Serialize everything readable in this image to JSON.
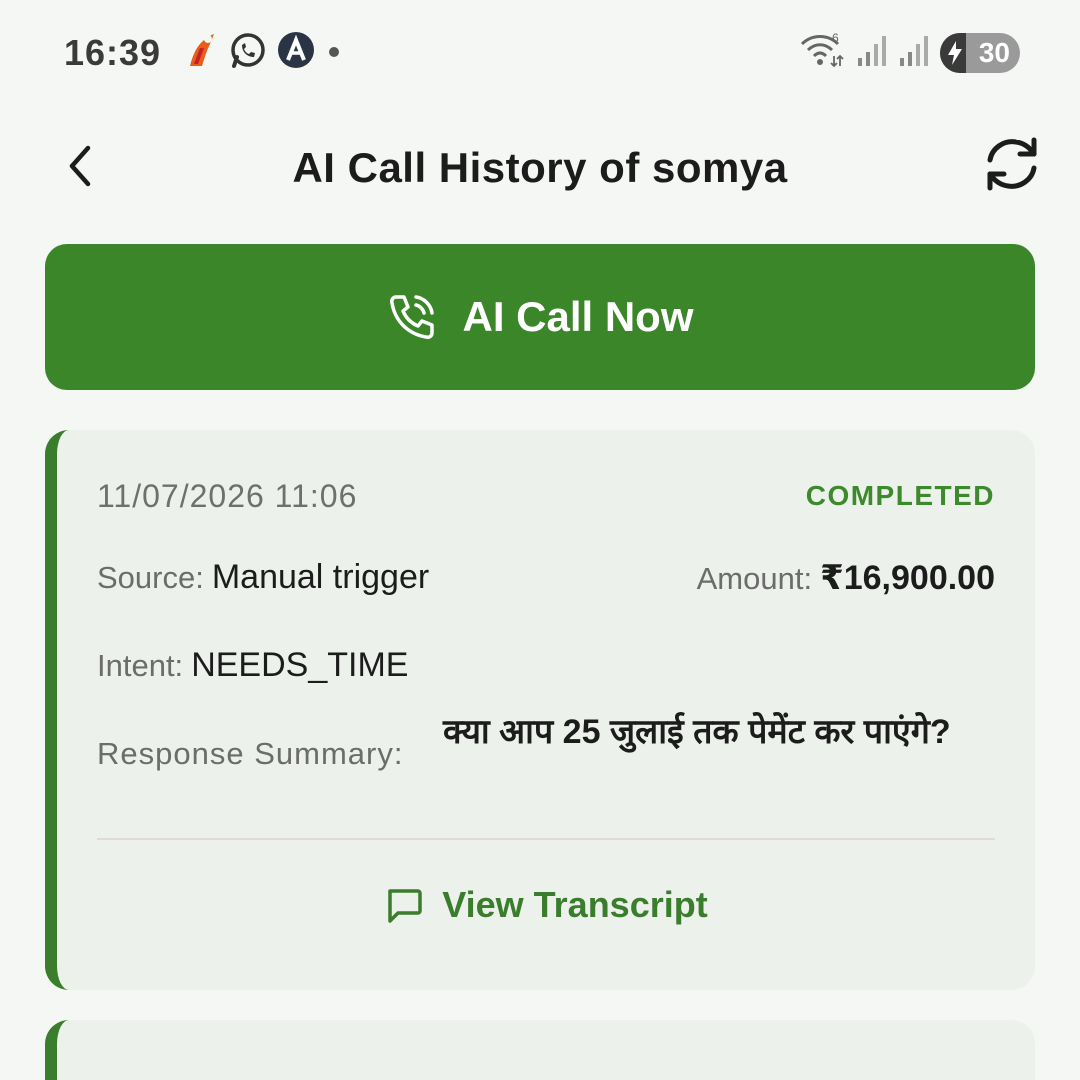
{
  "status_bar": {
    "time": "16:39",
    "battery": "30",
    "left_icons": [
      "ipay-icon",
      "whatsapp-icon",
      "a-app-icon",
      "dot-icon"
    ],
    "right_icons": [
      "wifi-icon",
      "signal-icon",
      "signal-icon",
      "battery-icon"
    ]
  },
  "header": {
    "title": "AI Call History of somya",
    "back_icon": "chevron-left-icon",
    "refresh_icon": "refresh-icon"
  },
  "cta": {
    "label": "AI Call Now",
    "icon": "phone-call-icon",
    "color": "#3a8628"
  },
  "call_records": [
    {
      "datetime": "11/07/2026 11:06",
      "status": "COMPLETED",
      "source_label": "Source:",
      "source_value": "Manual trigger",
      "amount_label": "Amount:",
      "amount_value": "₹16,900.00",
      "intent_label": "Intent:",
      "intent_value": "NEEDS_TIME",
      "summary_label": "Response Summary:",
      "summary_value": "क्या आप 25 जुलाई तक पेमेंट कर पाएंगे?",
      "transcript_label": "View Transcript",
      "transcript_icon": "message-square-icon"
    }
  ],
  "colors": {
    "accent": "#3a8628",
    "status_completed": "#3c8a2c",
    "card_bg": "#ecf1eb",
    "page_bg": "#f5f7f4"
  }
}
